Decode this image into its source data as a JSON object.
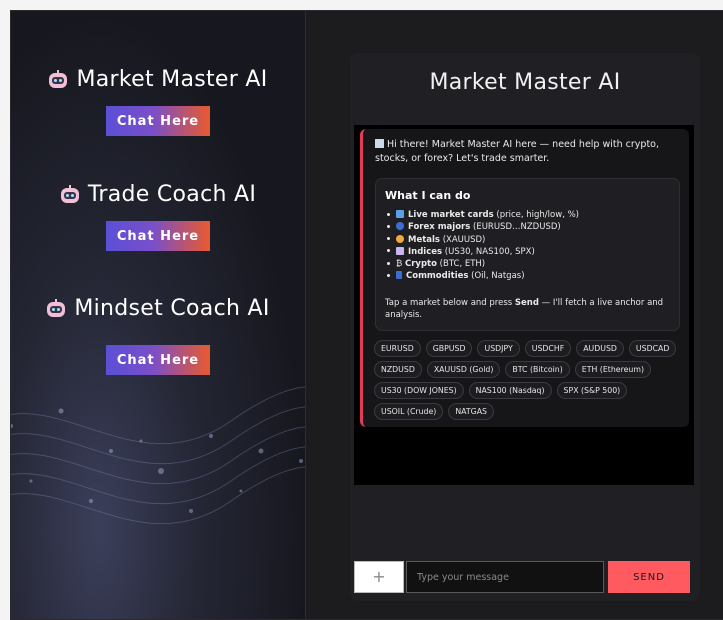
{
  "bots": [
    {
      "name": "Market Master AI",
      "button": "Chat Here"
    },
    {
      "name": "Trade Coach AI",
      "button": "Chat Here"
    },
    {
      "name": "Mindset Coach AI",
      "button": "Chat Here"
    }
  ],
  "chat": {
    "title": "Market Master AI",
    "greeting": "Hi there! Market Master AI here — need help with crypto, stocks, or forex? Let's trade smarter.",
    "capabilities_title": "What I can do",
    "capabilities": [
      {
        "bold": "Live market cards",
        "rest": " (price, high/low, %)",
        "icon": "chart-icon"
      },
      {
        "bold": "Forex majors",
        "rest": " (EURUSD…NZDUSD)",
        "icon": "globe-icon"
      },
      {
        "bold": "Metals",
        "rest": " (XAUUSD)",
        "icon": "gold-coin-icon"
      },
      {
        "bold": "Indices",
        "rest": " (US30, NAS100, SPX)",
        "icon": "chart-up-icon"
      },
      {
        "bold": "Crypto",
        "rest": " (BTC, ETH)",
        "icon": "bitcoin-icon",
        "prefix": "₿ "
      },
      {
        "bold": "Commodities",
        "rest": " (Oil, Natgas)",
        "icon": "oil-icon"
      }
    ],
    "note_start": "Tap a market below and press ",
    "note_bold": "Send",
    "note_end": " — I'll fetch a live anchor and analysis.",
    "chips": [
      "EURUSD",
      "GBPUSD",
      "USDJPY",
      "USDCHF",
      "AUDUSD",
      "USDCAD",
      "NZDUSD",
      "XAUUSD (Gold)",
      "BTC (Bitcoin)",
      "ETH (Ethereum)",
      "US30 (DOW JONES)",
      "NAS100 (Nasdaq)",
      "SPX (S&P 500)",
      "USOIL (Crude)",
      "NATGAS"
    ],
    "plus_label": "+",
    "input_placeholder": "Type your message",
    "send_label": "SEND"
  },
  "colors": {
    "accent": "#ff5a5f",
    "bubble_border": "#e23b5a",
    "button_gradient_start": "#5b4fd6",
    "button_gradient_end": "#e85a2e"
  }
}
